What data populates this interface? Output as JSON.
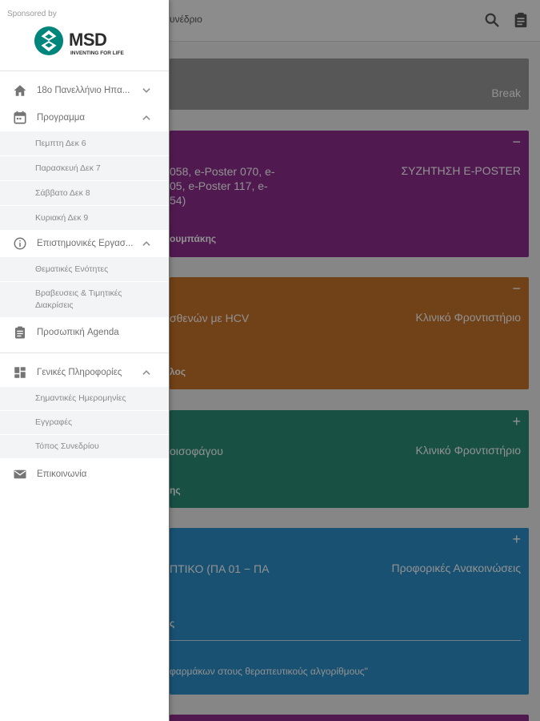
{
  "app": {
    "title_fragment": "υνέδριο",
    "search_icon": "search-icon",
    "clipboard_icon": "clipboard-icon"
  },
  "cards": [
    {
      "type": "",
      "title": "",
      "extra": "Break",
      "color": "#9a9a9a"
    },
    {
      "sign": "−",
      "title_line1": "058, e-Poster 070, e-",
      "title_line2": "05, e-Poster 117, e-",
      "title_line3": "54)",
      "type": "ΣΥΖΗΤΗΣΗ E-POSTER",
      "sub": "ουμπάκης",
      "color": "#8e2e8e"
    },
    {
      "sign": "−",
      "title_line1": "σθενών με HCV",
      "type": "Κλινικό Φροντιστήριο",
      "sub": "λος",
      "color": "#c7722a"
    },
    {
      "sign": "+",
      "title_line1": "οισοφάγου",
      "type": "Κλινικό Φροντιστήριο",
      "sub": "ης",
      "color": "#2b8e78"
    },
    {
      "sign": "+",
      "title_line1": "ΠΤΙΚΟ (ΠΑ 01 − ΠΑ",
      "type": "Προφορικές Ανακοινώσεις",
      "sub": "ς",
      "note": "φαρμάκων στους θεραπευτικούς αλγορίθμους\"",
      "color": "#2d8fc8"
    },
    {
      "color": "#8e2e8e"
    }
  ],
  "drawer": {
    "sponsor_label": "Sponsored by",
    "logo_name": "MSD",
    "logo_tagline": "INVENTING FOR LIFE",
    "items": [
      {
        "label": "18ο Πανελλήνιο Ηπα...",
        "icon": "home-icon",
        "chevron": "chevron-down-icon"
      },
      {
        "label": "Προγραμμα",
        "icon": "calendar-icon",
        "chevron": "chevron-up-icon",
        "children": [
          "Πεμπτη Δεκ 6",
          "Παρασκευή Δεκ 7",
          "Σάββατο Δεκ 8",
          "Κυριακή Δεκ 9"
        ]
      },
      {
        "label": "Επιστημονικές Εργασ...",
        "icon": "info-icon",
        "chevron": "chevron-up-icon",
        "children": [
          "Θεματικές Ενότητες",
          "Βραβευσεις & Τιμητικές",
          "Διακρίσεις"
        ]
      },
      {
        "label": "Προσωπική Agenda",
        "icon": "clipboard-icon"
      },
      {
        "label": "Γενικές Πληροφορίες",
        "icon": "dashboard-icon",
        "chevron": "chevron-up-icon",
        "children": [
          "Σημαντικές Ημερομηνίες",
          "Εγγραφές",
          "Τόπος Συνεδρίου"
        ]
      },
      {
        "label": "Επικοινωνία",
        "icon": "mail-icon"
      }
    ]
  }
}
